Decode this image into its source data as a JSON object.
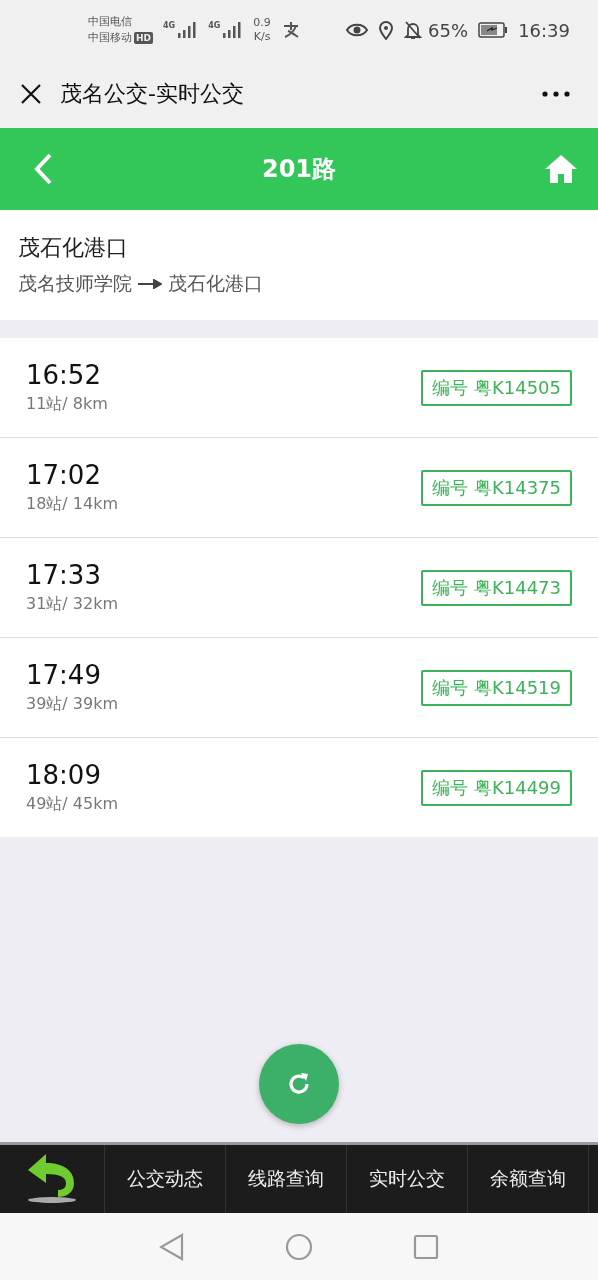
{
  "status_bar": {
    "carrier_1": "中国电信",
    "carrier_2": "中国移动",
    "hd": "HD",
    "network_1": "4G",
    "network_2": "4G",
    "speed": "0.9",
    "speed_unit": "K/s",
    "battery": "65%",
    "time": "16:39"
  },
  "title_bar": {
    "title": "茂名公交-实时公交"
  },
  "header": {
    "title": "201路"
  },
  "route": {
    "destination": "茂石化港口",
    "from": "茂名技师学院",
    "to": "茂石化港口"
  },
  "arrivals": [
    {
      "time": "16:52",
      "distance": "11站/ 8km",
      "plate": "编号 粤K14505"
    },
    {
      "time": "17:02",
      "distance": "18站/ 14km",
      "plate": "编号 粤K14375"
    },
    {
      "time": "17:33",
      "distance": "31站/ 32km",
      "plate": "编号 粤K14473"
    },
    {
      "time": "17:49",
      "distance": "39站/ 39km",
      "plate": "编号 粤K14519"
    },
    {
      "time": "18:09",
      "distance": "49站/ 45km",
      "plate": "编号 粤K14499"
    }
  ],
  "bottom_nav": [
    "公交动态",
    "线路查询",
    "实时公交",
    "余额查询"
  ]
}
